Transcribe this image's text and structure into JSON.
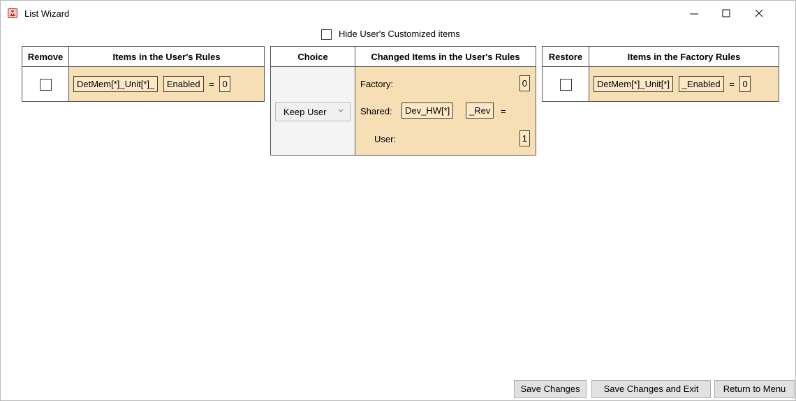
{
  "window": {
    "title": "List Wizard",
    "icon": "app-logo-icon"
  },
  "options": {
    "hide_customized_label": "Hide User's Customized items",
    "hide_customized_checked": false
  },
  "user_rules": {
    "col_remove": "Remove",
    "col_items": "Items in the User's Rules",
    "rows": [
      {
        "remove_checked": false,
        "name": "DetMem[*]_Unit[*]_",
        "field": "Enabled",
        "equals": "=",
        "value": "0"
      }
    ]
  },
  "choice": {
    "col_choice": "Choice",
    "col_changed": "Changed Items in the User's Rules",
    "selected": "Keep User",
    "factory_label": "Factory:",
    "factory_value": "0",
    "shared_label": "Shared:",
    "shared_name": "Dev_HW[*]",
    "shared_field": "_Rev",
    "shared_equals": "=",
    "user_label": "User:",
    "user_value": "1"
  },
  "factory_rules": {
    "col_restore": "Restore",
    "col_items": "Items in the Factory Rules",
    "rows": [
      {
        "restore_checked": false,
        "name": "DetMem[*]_Unit[*]",
        "field": "_Enabled",
        "equals": "=",
        "value": "0"
      }
    ]
  },
  "buttons": {
    "save": "Save Changes",
    "save_exit": "Save Changes and Exit",
    "return": "Return to Menu"
  },
  "colors": {
    "highlight_bg": "#f6deb5",
    "chip_bg": "#fbe8c8",
    "app_icon": "#c42b1c"
  }
}
